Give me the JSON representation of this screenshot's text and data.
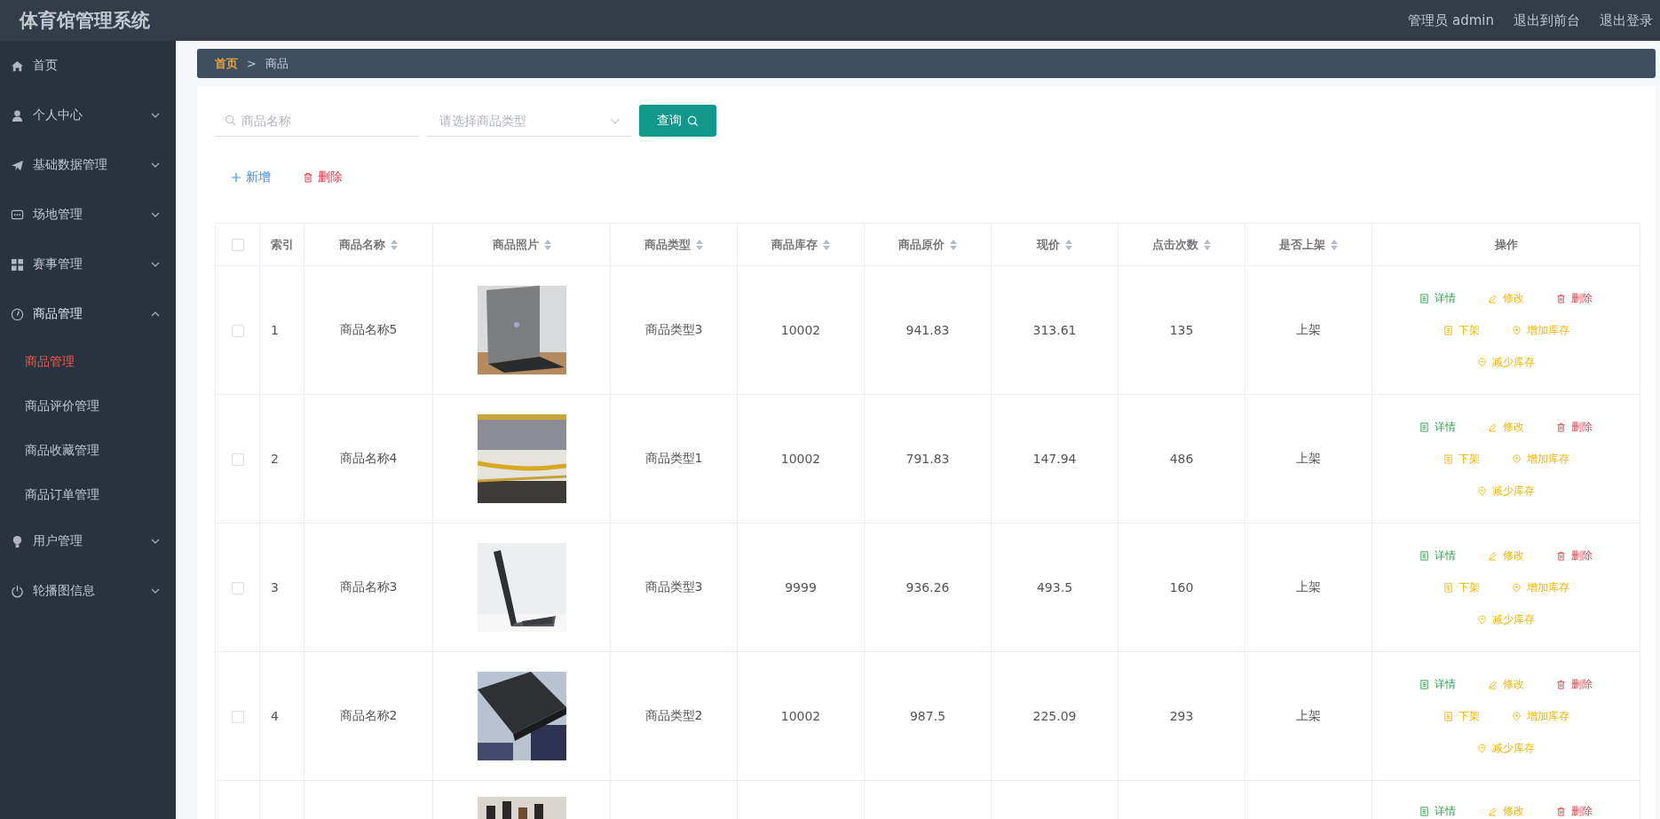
{
  "header": {
    "title": "体育馆管理系统",
    "links": [
      "管理员 admin",
      "退出到前台",
      "退出登录"
    ]
  },
  "sidebar": {
    "items": [
      {
        "label": "首页"
      },
      {
        "label": "个人中心",
        "expanded": false
      },
      {
        "label": "基础数据管理",
        "expanded": false
      },
      {
        "label": "场地管理",
        "expanded": false
      },
      {
        "label": "赛事管理",
        "expanded": false
      },
      {
        "label": "商品管理",
        "expanded": true,
        "children": [
          {
            "label": "商品管理",
            "selected": true
          },
          {
            "label": "商品评价管理",
            "selected": false
          },
          {
            "label": "商品收藏管理",
            "selected": false
          },
          {
            "label": "商品订单管理",
            "selected": false
          }
        ]
      },
      {
        "label": "用户管理",
        "expanded": false
      },
      {
        "label": "轮播图信息",
        "expanded": false
      }
    ]
  },
  "breadcrumb": [
    "首页",
    "商品"
  ],
  "breadcrumb_separator": ">",
  "search": {
    "name_placeholder": "商品名称",
    "type_placeholder": "请选择商品类型",
    "button": "查询"
  },
  "toolbar": {
    "add": "新增",
    "delete": "删除"
  },
  "table": {
    "select_all_checked": false,
    "columns": [
      {
        "label": "索引",
        "sortable": false
      },
      {
        "label": "商品名称",
        "sortable": true
      },
      {
        "label": "商品照片",
        "sortable": true
      },
      {
        "label": "商品类型",
        "sortable": true
      },
      {
        "label": "商品库存",
        "sortable": true
      },
      {
        "label": "商品原价",
        "sortable": true
      },
      {
        "label": "现价",
        "sortable": true
      },
      {
        "label": "点击次数",
        "sortable": true
      },
      {
        "label": "是否上架",
        "sortable": true
      },
      {
        "label": "操作",
        "sortable": false
      }
    ],
    "rows": [
      {
        "checked": false,
        "cells": [
          "1",
          "商品名称5",
          "商品类型3",
          "10002",
          "941.83",
          "313.61",
          "135",
          "上架"
        ],
        "photo": {
          "kind": "picture"
        },
        "actions": [
          "详情",
          "修改",
          "删除",
          "下架",
          "增加库存",
          "减少库存"
        ]
      },
      {
        "checked": false,
        "cells": [
          "2",
          "商品名称4",
          "商品类型1",
          "10002",
          "791.83",
          "147.94",
          "486",
          "上架"
        ],
        "photo": {
          "kind": "picture"
        },
        "actions": [
          "详情",
          "修改",
          "删除",
          "下架",
          "增加库存",
          "减少库存"
        ]
      },
      {
        "checked": false,
        "cells": [
          "3",
          "商品名称3",
          "商品类型3",
          "9999",
          "936.26",
          "493.5",
          "160",
          "上架"
        ],
        "photo": {
          "kind": "picture"
        },
        "actions": [
          "详情",
          "修改",
          "删除",
          "下架",
          "增加库存",
          "减少库存"
        ]
      },
      {
        "checked": false,
        "cells": [
          "4",
          "商品名称2",
          "商品类型2",
          "10002",
          "987.5",
          "225.09",
          "293",
          "上架"
        ],
        "photo": {
          "kind": "picture"
        },
        "actions": [
          "详情",
          "修改",
          "删除",
          "下架",
          "增加库存",
          "减少库存"
        ]
      },
      {
        "photo": {
          "kind": "picture"
        },
        "actions": [
          "详情",
          "修改",
          "删除"
        ]
      }
    ]
  }
}
